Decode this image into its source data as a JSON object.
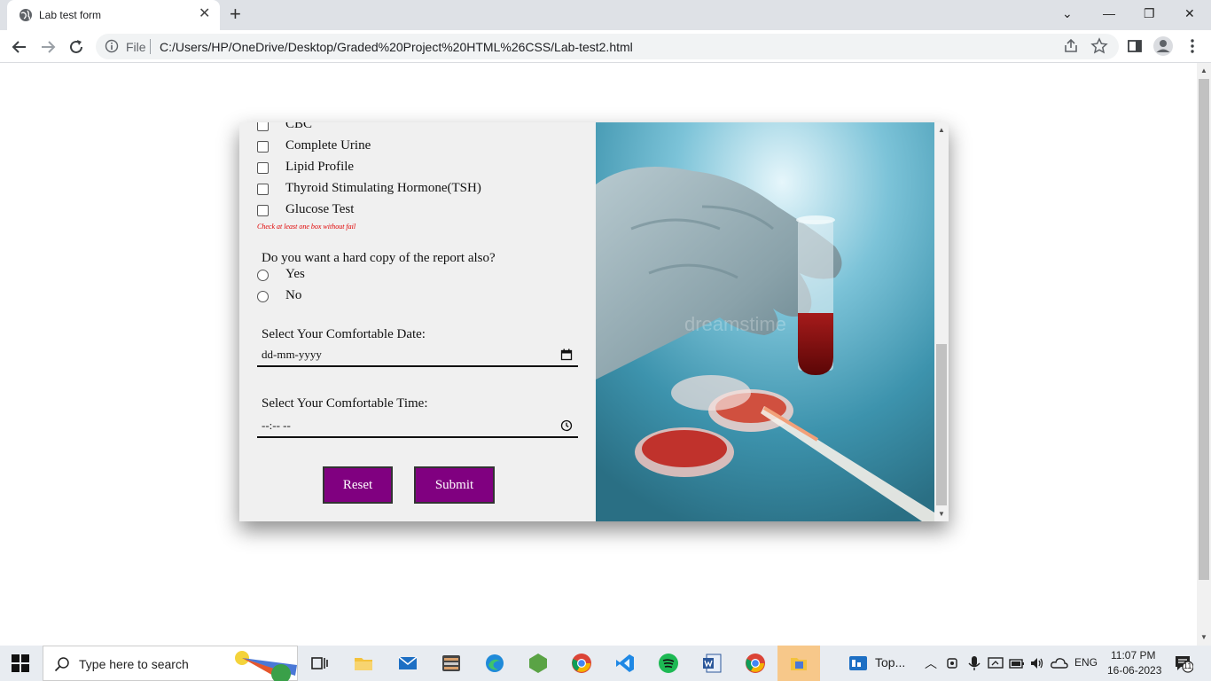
{
  "browser": {
    "tab_title": "Lab test form",
    "new_tab": "+",
    "close_tab": "✕",
    "scheme_label": "File",
    "url": "C:/Users/HP/OneDrive/Desktop/Graded%20Project%20HTML%26CSS/Lab-test2.html",
    "window_controls": [
      "⌄",
      "—",
      "❐",
      "✕"
    ]
  },
  "form": {
    "tests": [
      {
        "label": "CBC",
        "checked": false
      },
      {
        "label": "Complete Urine",
        "checked": false
      },
      {
        "label": "Lipid Profile",
        "checked": false
      },
      {
        "label": "Thyroid Stimulating Hormone(TSH)",
        "checked": false
      },
      {
        "label": "Glucose Test",
        "checked": false
      }
    ],
    "warning": "Check at least one box without fail",
    "hardcopy_question": "Do you want a hard copy of the report also?",
    "hardcopy_options": [
      "Yes",
      "No"
    ],
    "date_label": "Select Your Comfortable Date:",
    "date_value": "dd-mm-yyyy",
    "time_label": "Select Your Comfortable Time:",
    "time_value": "--:-- --",
    "reset_label": "Reset",
    "submit_label": "Submit",
    "button_color": "#800080",
    "warning_color": "#e00000"
  },
  "image": {
    "watermark": "dreamstime"
  },
  "taskbar": {
    "search_placeholder": "Type here to search",
    "window_label": "Top...",
    "language": "ENG",
    "time": "11:07 PM",
    "date": "16-06-2023",
    "notification_count": "11"
  }
}
